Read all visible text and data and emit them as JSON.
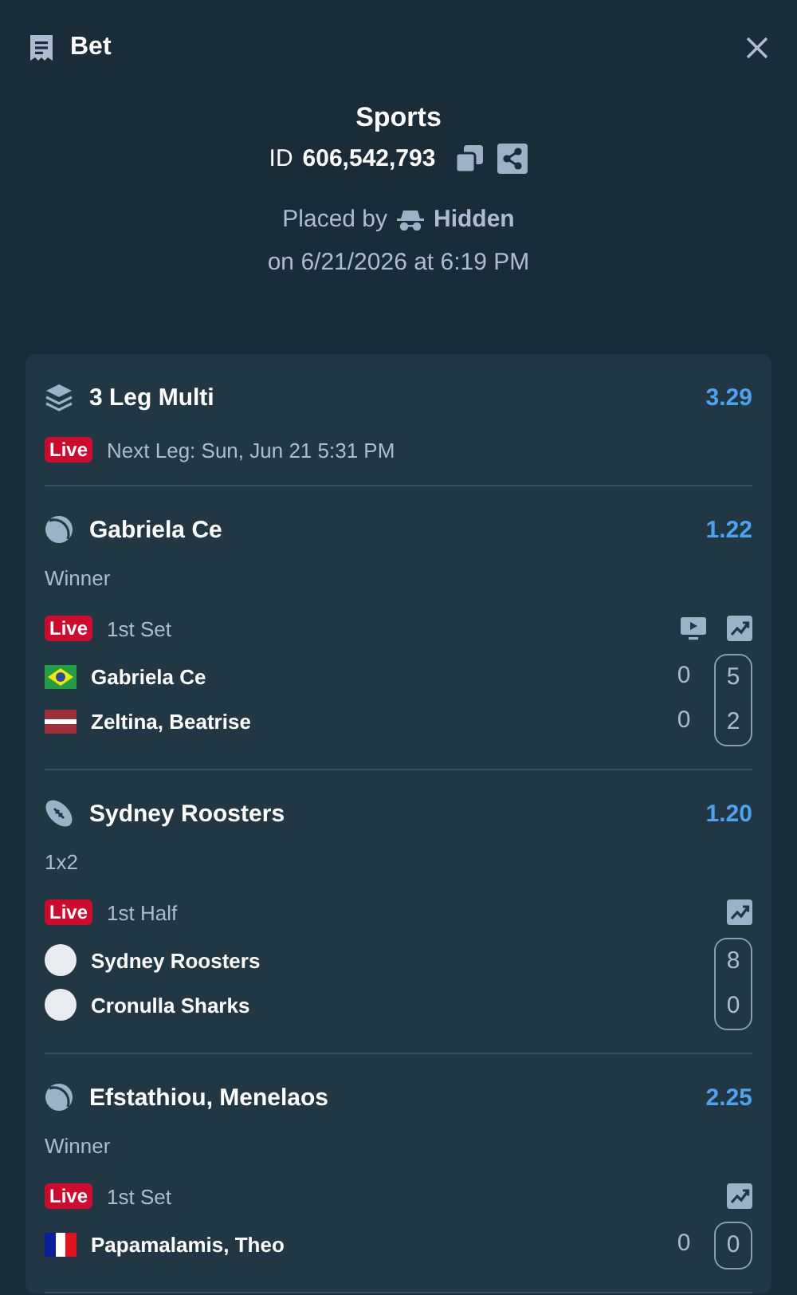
{
  "header": {
    "title": "Bet"
  },
  "summary": {
    "category": "Sports",
    "id_label": "ID",
    "id_value": "606,542,793",
    "placed_by_label": "Placed by",
    "placed_by_name": "Hidden",
    "placed_on": "on 6/21/2026 at 6:19 PM"
  },
  "multi": {
    "title": "3 Leg Multi",
    "odds": "3.29",
    "status": "Live",
    "next_leg": "Next Leg: Sun, Jun 21 5:31 PM"
  },
  "legs": [
    {
      "kind": "tennis",
      "title": "Gabriela Ce",
      "odds": "1.22",
      "market": "Winner",
      "status": "Live",
      "period": "1st Set",
      "has_stream": true,
      "has_stats": true,
      "competitors": [
        {
          "name": "Gabriela Ce",
          "kind": "br"
        },
        {
          "name": "Zeltina, Beatrise",
          "kind": "lv"
        }
      ],
      "score_columns": [
        [
          "0",
          "0"
        ],
        [
          "5",
          "2"
        ]
      ]
    },
    {
      "kind": "rugby",
      "title": "Sydney Roosters",
      "odds": "1.20",
      "market": "1x2",
      "status": "Live",
      "period": "1st Half",
      "has_stream": false,
      "has_stats": true,
      "competitors": [
        {
          "name": "Sydney Roosters",
          "kind": "logo"
        },
        {
          "name": "Cronulla Sharks",
          "kind": "logo"
        }
      ],
      "score_columns": [
        [
          "8",
          "0"
        ]
      ]
    },
    {
      "kind": "tennis",
      "title": "Efstathiou, Menelaos",
      "odds": "2.25",
      "market": "Winner",
      "status": "Live",
      "period": "1st Set",
      "has_stream": false,
      "has_stats": true,
      "competitors": [
        {
          "name": "Papamalamis, Theo",
          "kind": "fr"
        }
      ],
      "score_columns": [
        [
          "0"
        ],
        [
          "0"
        ]
      ]
    }
  ]
}
